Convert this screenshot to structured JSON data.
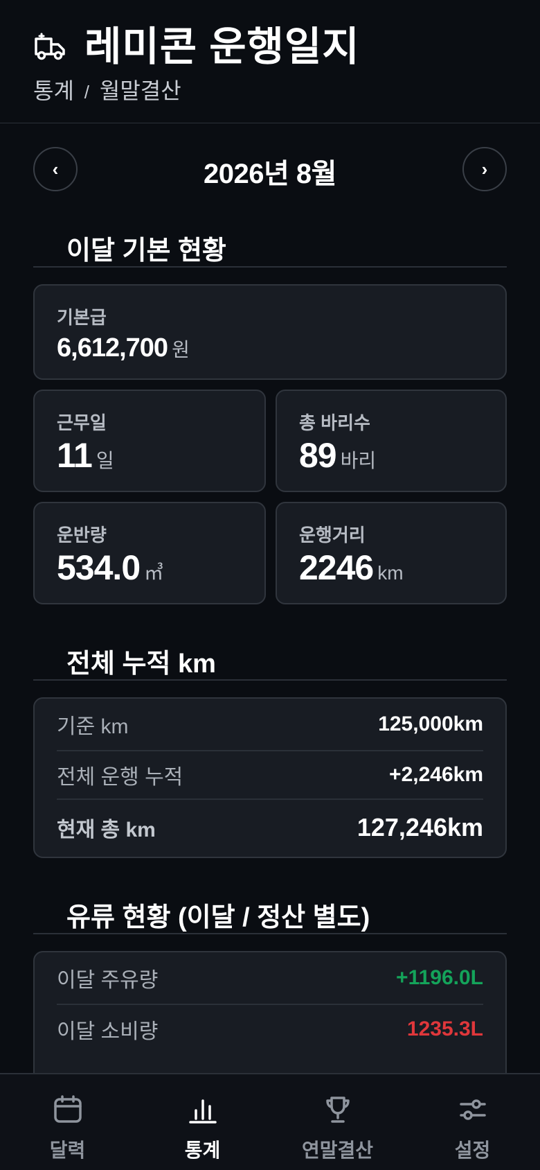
{
  "header": {
    "title": "레미콘 운행일지",
    "breadcrumb_parent": "통계",
    "breadcrumb_sep": "/",
    "breadcrumb_current": "월말결산",
    "icon": "truck-icon"
  },
  "month_nav": {
    "prev": "‹",
    "label": "2026년 8월",
    "next": "›"
  },
  "basic": {
    "section_title": "이달 기본 현황",
    "salary": {
      "label": "기본급",
      "value": "6,612,700",
      "unit": "원"
    },
    "workdays": {
      "label": "근무일",
      "value": "11",
      "unit": "일"
    },
    "trips": {
      "label": "총 바리수",
      "value": "89",
      "unit": "바리"
    },
    "volume": {
      "label": "운반량",
      "value": "534.0",
      "unit": "㎥"
    },
    "distance": {
      "label": "운행거리",
      "value": "2246",
      "unit": "km"
    }
  },
  "cumulative": {
    "section_title": "전체 누적 km",
    "rows": [
      {
        "key": "기준 km",
        "value": "125,000km"
      },
      {
        "key": "전체 운행 누적",
        "value": "+2,246km"
      },
      {
        "key": "현재 총 km",
        "value": "127,246km"
      }
    ]
  },
  "fuel": {
    "section_title": "유류 현황 (이달 / 정산 별도)",
    "rows": [
      {
        "key": "이달 주유량",
        "value": "+1196.0L"
      },
      {
        "key": "이달 소비량",
        "value": "1235.3L"
      }
    ]
  },
  "colors": {
    "accent_green": "#14a35a",
    "accent_red": "#e0373b",
    "background": "#0a0d12",
    "card": "#181c23"
  },
  "bottom_nav": [
    {
      "label": "달력",
      "icon": "calendar-icon",
      "active": false
    },
    {
      "label": "통계",
      "icon": "chart-icon",
      "active": true
    },
    {
      "label": "연말결산",
      "icon": "trophy-icon",
      "active": false
    },
    {
      "label": "설정",
      "icon": "sliders-icon",
      "active": false
    }
  ]
}
